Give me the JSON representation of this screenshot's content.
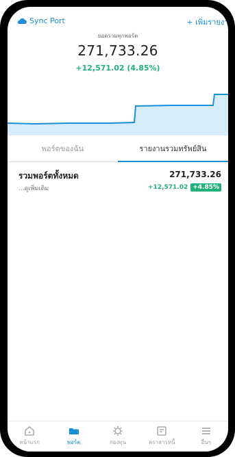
{
  "header": {
    "sync_label": "Sync Port",
    "add_label": "+ เพิ่มรายงาน",
    "total_label": "ยอดรวมทุกพอร์ต",
    "total_value": "271,733.26",
    "total_change": "+12,571.02 (4.85%)"
  },
  "colors": {
    "accent": "#1a8fd8",
    "positive": "#21b07a",
    "chart_fill": "#d6ecfb"
  },
  "tabs": [
    {
      "label": "พอร์ตของฉัน",
      "active": false
    },
    {
      "label": "รายงานรวมทรัพย์สิน",
      "active": true
    }
  ],
  "portfolio": {
    "title": "รวมพอร์ตทั้งหมด",
    "subtitle": "...ดูเพิ่มเติม",
    "value": "271,733.26",
    "change": "+12,571.02",
    "change_pct": "+4.85%"
  },
  "nav": [
    {
      "label": "หน้าแรก",
      "icon": "home-icon",
      "active": false
    },
    {
      "label": "พอร์ต",
      "icon": "folder-icon",
      "active": true
    },
    {
      "label": "กองทุน",
      "icon": "fund-icon",
      "active": false
    },
    {
      "label": "ตราสารหนี้",
      "icon": "bond-icon",
      "active": false
    },
    {
      "label": "อื่นๆ",
      "icon": "menu-icon",
      "active": false
    }
  ]
}
